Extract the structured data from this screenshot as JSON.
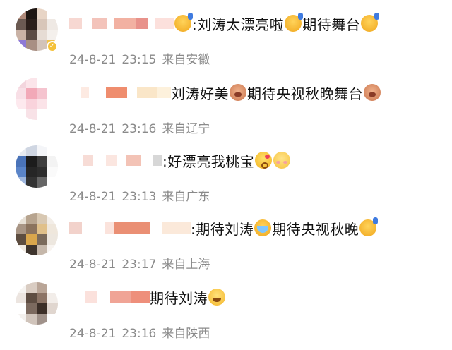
{
  "comments": [
    {
      "avatar_colors": [
        "#b08a7a",
        "#1e1612",
        "#e8d5c6",
        "#fff",
        "#6b5a52",
        "#2b1f1a",
        "#d8c6b9",
        "#efe9e4",
        "#c9b2a5",
        "#5c4c45",
        "#e6dcd4",
        "#f4f0ec",
        "#8e79d6",
        "#a88f83",
        "#d2c3b9",
        "#f1c24a"
      ],
      "mosaic": [
        "#f7d8d2",
        "#fff",
        "#f3c3ba",
        "#fff",
        "#f2b1a2",
        "#e8928b",
        "#fff",
        "#fce0dc"
      ],
      "segments": [
        {
          "type": "emoji",
          "icon": "cheer-emoji"
        },
        {
          "type": "text",
          "value": ":刘涛太漂亮啦"
        },
        {
          "type": "emoji",
          "icon": "cheer-emoji"
        },
        {
          "type": "text",
          "value": "期待舞台"
        },
        {
          "type": "emoji",
          "icon": "cheer-emoji"
        }
      ],
      "date": "24-8-21",
      "time": "23:15",
      "location": "来自安徽"
    },
    {
      "avatar_colors": [
        "#f3d5dd",
        "#fbe5ea",
        "#fff",
        "#fff",
        "#f8dfe6",
        "#f2a9b8",
        "#f5c4cf",
        "#fff",
        "#fde9ee",
        "#f9d3dc",
        "#fbe3e8",
        "#fff",
        "#fff",
        "#f8e2e7",
        "#fff",
        "#fff"
      ],
      "mosaic": [
        "#fff",
        "#fdeae2",
        "#fff",
        "#ef8d6e",
        "#fff",
        "#fae6c8",
        "#fdf1dc"
      ],
      "segments": [
        {
          "type": "text",
          "value": "刘涛好美"
        },
        {
          "type": "emoji",
          "icon": "pig-emoji"
        },
        {
          "type": "text",
          "value": "期待央视秋晚舞台"
        },
        {
          "type": "emoji",
          "icon": "pig-emoji"
        }
      ],
      "date": "24-8-21",
      "time": "23:16",
      "location": "来自辽宁"
    },
    {
      "avatar_colors": [
        "#e6eaf0",
        "#cfd6e2",
        "#f4f5f8",
        "#fff",
        "#4a73b8",
        "#1c1c1c",
        "#3d3d3d",
        "#f3f3f3",
        "#5a84c8",
        "#262626",
        "#2d2d2d",
        "#fafafa",
        "#9eb6dd",
        "#333",
        "#666",
        "#fff"
      ],
      "mosaic": [
        "#fff",
        "#f7dcd6",
        "#fff",
        "#fbe6e0",
        "#fff",
        "#f3c3b6",
        "#fff",
        "#d7d7d7"
      ],
      "segments": [
        {
          "type": "text",
          "value": ":好漂亮我桃宝"
        },
        {
          "type": "emoji",
          "icon": "kiss-emoji"
        },
        {
          "type": "emoji",
          "icon": "shy-emoji"
        }
      ],
      "date": "24-8-21",
      "time": "23:13",
      "location": "来自广东"
    },
    {
      "avatar_colors": [
        "#e7e0d6",
        "#b7a48f",
        "#d8c8b2",
        "#f3eee8",
        "#a89585",
        "#8b735e",
        "#e0c08a",
        "#efe7dc",
        "#5d4d40",
        "#d9a64c",
        "#7a6a5b",
        "#ede7df",
        "#efe9e2",
        "#3e342d",
        "#c5b7aa",
        "#f8f4f0"
      ],
      "mosaic": [
        "#f2d2cb",
        "#fff",
        "#fff",
        "#fbe3dc",
        "#ea8f74",
        "#fff",
        "#fbe9da"
      ],
      "segments": [
        {
          "type": "text",
          "value": ":期待刘涛"
        },
        {
          "type": "emoji",
          "icon": "cry-emoji"
        },
        {
          "type": "text",
          "value": "期待央视秋晚"
        },
        {
          "type": "emoji",
          "icon": "cheer-emoji"
        }
      ],
      "date": "24-8-21",
      "time": "23:17",
      "location": "来自上海"
    },
    {
      "avatar_colors": [
        "#f6f3f0",
        "#d9ccc2",
        "#b9a597",
        "#fff",
        "#ece5e0",
        "#5e4d42",
        "#8c7466",
        "#f2ede9",
        "#fff",
        "#7c6a5f",
        "#3c2f28",
        "#e0d6cf",
        "#f4f1ee",
        "#d0c4bb",
        "#a0928a",
        "#fff"
      ],
      "mosaic": [
        "#fff",
        "#fbe1dc",
        "#fff",
        "#f0a496",
        "#ee8f7b"
      ],
      "segments": [
        {
          "type": "text",
          "value": "期待刘涛"
        },
        {
          "type": "emoji",
          "icon": "grin-emoji"
        }
      ],
      "date": "24-8-21",
      "time": "23:16",
      "location": "来自陕西"
    }
  ]
}
